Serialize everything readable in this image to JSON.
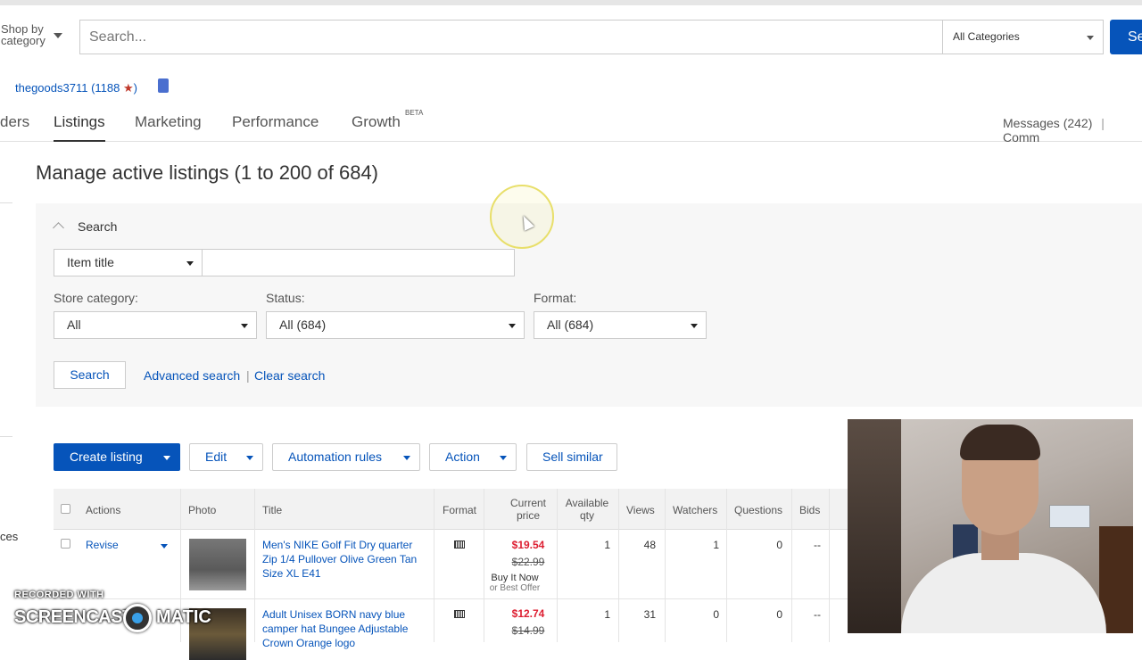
{
  "header": {
    "shop_by_line1": "Shop by",
    "shop_by_line2": "category",
    "search_placeholder": "Search...",
    "category_select": "All Categories",
    "search_button": "Se"
  },
  "seller": {
    "name": "thegoods3711",
    "feedback_open": "(1188",
    "star": "★",
    "feedback_close": ")"
  },
  "nav": {
    "tabs": [
      "ders",
      "Listings",
      "Marketing",
      "Performance",
      "Growth"
    ],
    "growth_badge": "BETA",
    "active": "Listings",
    "messages": "Messages (242)",
    "messages_sep": "|",
    "community": "Comm"
  },
  "page": {
    "title": "Manage active listings (1 to 200 of 684)",
    "left_fragment": "ces"
  },
  "filters": {
    "toggle_label": "Search",
    "search_field_select": "Item title",
    "search_field_value": "",
    "store_category_label": "Store category:",
    "store_category_value": "All",
    "status_label": "Status:",
    "status_value": "All (684)",
    "format_label": "Format:",
    "format_value": "All (684)",
    "search_button": "Search",
    "advanced_search": "Advanced search",
    "separator": "|",
    "clear_search": "Clear search"
  },
  "toolbar": {
    "create_listing": "Create listing",
    "edit": "Edit",
    "automation_rules": "Automation rules",
    "action": "Action",
    "sell_similar": "Sell similar"
  },
  "table": {
    "headers": {
      "actions": "Actions",
      "photo": "Photo",
      "title": "Title",
      "format": "Format",
      "current_price_1": "Current",
      "current_price_2": "price",
      "available_qty_1": "Available",
      "available_qty_2": "qty",
      "views": "Views",
      "watchers": "Watchers",
      "questions": "Questions",
      "bids": "Bids"
    },
    "rows": [
      {
        "action": "Revise",
        "title": "Men's NIKE Golf Fit Dry quarter Zip 1/4 Pullover Olive Green Tan Size XL E41",
        "price": "$19.54",
        "old_price": "$22.99",
        "buy_it_now": "Buy It Now",
        "best_offer": "or Best Offer",
        "qty": "1",
        "views": "48",
        "watchers": "1",
        "questions": "0",
        "bids": "--"
      },
      {
        "action": "",
        "title": "Adult Unisex BORN navy blue camper hat Bungee Adjustable Crown Orange logo",
        "price": "$12.74",
        "old_price": "$14.99",
        "qty": "1",
        "views": "31",
        "watchers": "0",
        "questions": "0",
        "bids": "--"
      }
    ]
  },
  "watermark": {
    "recorded_with": "RECORDED WITH",
    "screencast": "SCREENCAST",
    "matic": "MATIC"
  },
  "icons": [
    "caret-down-icon",
    "chevron-up-icon",
    "auction-format-icon",
    "seller-badge-icon",
    "mouse-cursor-icon"
  ]
}
